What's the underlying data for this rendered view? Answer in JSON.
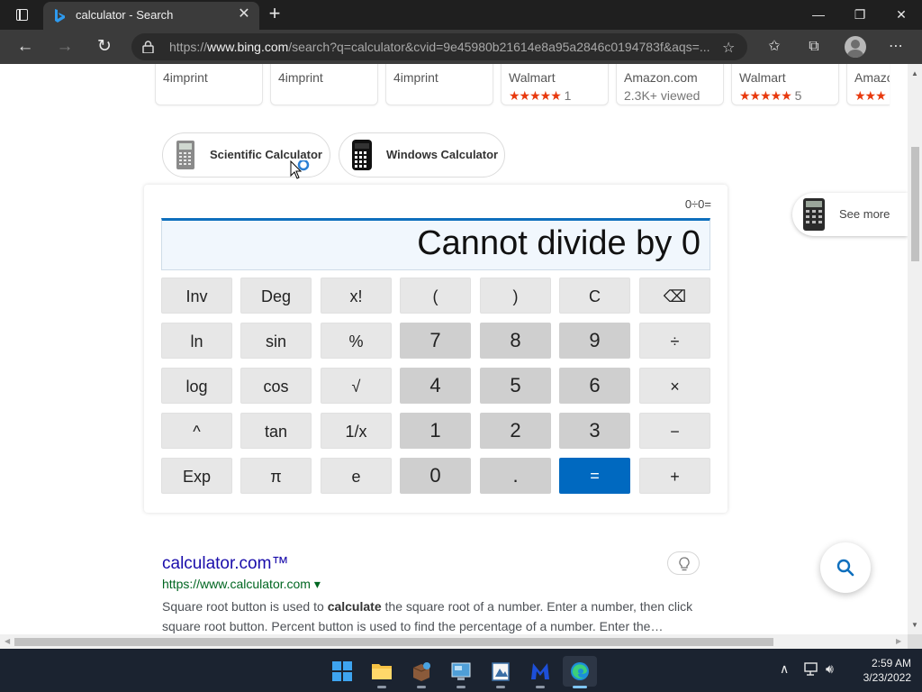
{
  "browser": {
    "tab_title": "calculator - Search",
    "url_prefix": "https://",
    "url_domain": "www.bing.com",
    "url_rest": "/search?q=calculator&cvid=9e45980b21614e8a95a2846c0194783f&aqs=...",
    "new_tab": "+",
    "close": "✕"
  },
  "product_cards": [
    {
      "store": "4imprint",
      "sub": ""
    },
    {
      "store": "4imprint",
      "sub": ""
    },
    {
      "store": "4imprint",
      "sub": ""
    },
    {
      "store": "Walmart",
      "stars": "★★★★★",
      "sub": "1"
    },
    {
      "store": "Amazon.com",
      "sub": "2.3K+ viewed"
    },
    {
      "store": "Walmart",
      "stars": "★★★★★",
      "sub": "5"
    },
    {
      "store": "Amazo",
      "stars": "★★★",
      "sub": ""
    }
  ],
  "chips": {
    "scientific": "Scientific Calculator",
    "windows": "Windows Calculator",
    "see_more": "See more"
  },
  "calculator": {
    "history": "0÷0=",
    "display": "Cannot divide by 0",
    "keys": [
      [
        "Inv",
        "Deg",
        "x!",
        "(",
        ")",
        "C",
        "⌫"
      ],
      [
        "ln",
        "sin",
        "%",
        "7",
        "8",
        "9",
        "÷"
      ],
      [
        "log",
        "cos",
        "√",
        "4",
        "5",
        "6",
        "×"
      ],
      [
        "^",
        "tan",
        "1/x",
        "1",
        "2",
        "3",
        "−"
      ],
      [
        "Exp",
        "π",
        "e",
        "0",
        ".",
        "=",
        "+"
      ]
    ]
  },
  "result": {
    "title": "calculator.com™",
    "url": "https://www.calculator.com ▾",
    "snippet_before": "Square root button is used to ",
    "snippet_bold": "calculate",
    "snippet_after": " the square root of a number. Enter a number, then click square root button. Percent button is used to find the percentage of a number. Enter the…"
  },
  "taskbar": {
    "time": "2:59 AM",
    "date": "3/23/2022"
  },
  "colors": {
    "accent": "#0069c0",
    "link": "#1a0dab",
    "url_green": "#006621",
    "stars": "#e8390e"
  }
}
